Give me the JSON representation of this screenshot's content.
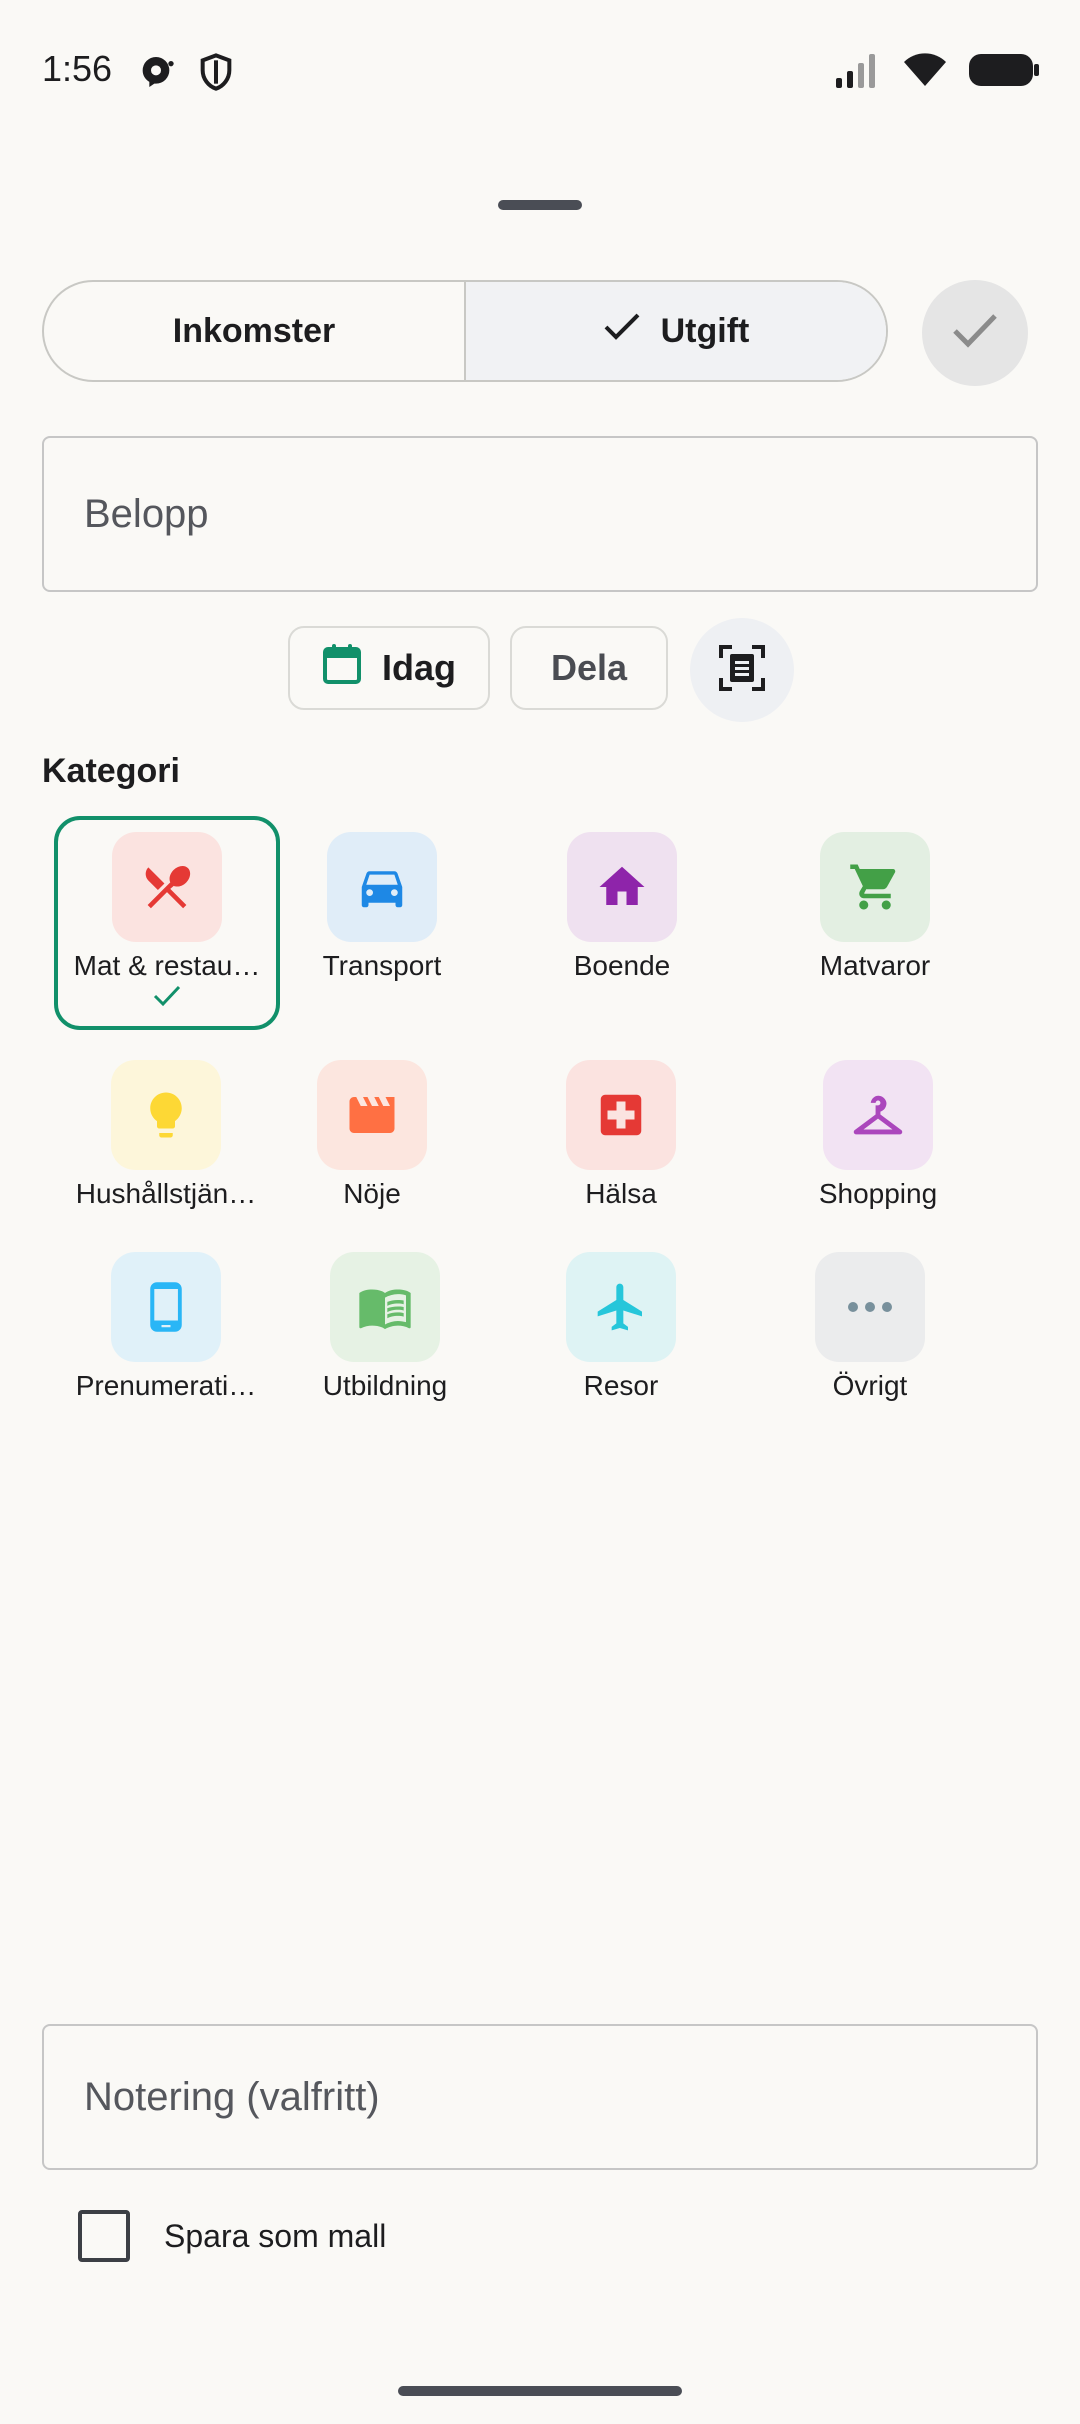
{
  "status_bar": {
    "time": "1:56",
    "icons": [
      "notification-icon",
      "shield-icon",
      "signal-icon",
      "wifi-icon",
      "battery-icon"
    ]
  },
  "type_toggle": {
    "income_label": "Inkomster",
    "expense_label": "Utgift",
    "selected": "Utgift"
  },
  "amount": {
    "placeholder": "Belopp",
    "value": ""
  },
  "chips": {
    "date_label": "Idag",
    "split_label": "Dela",
    "scan_icon": "scan-receipt-icon"
  },
  "category_section": {
    "title": "Kategori",
    "selected": "Mat & restau…",
    "items": [
      {
        "label": "Mat & restau…",
        "icon": "restaurant-icon",
        "color": "#e53935",
        "bg": "#fbe3e0"
      },
      {
        "label": "Transport",
        "icon": "car-icon",
        "color": "#1e88e5",
        "bg": "#e0edf8"
      },
      {
        "label": "Boende",
        "icon": "home-icon",
        "color": "#8e24aa",
        "bg": "#efe1f0"
      },
      {
        "label": "Matvaror",
        "icon": "cart-icon",
        "color": "#43a047",
        "bg": "#e3efe2"
      },
      {
        "label": "Hushållstjän…",
        "icon": "lightbulb-icon",
        "color": "#fdd835",
        "bg": "#fdf6da"
      },
      {
        "label": "Nöje",
        "icon": "movie-icon",
        "color": "#ff7043",
        "bg": "#fce6df"
      },
      {
        "label": "Hälsa",
        "icon": "medical-icon",
        "color": "#e53935",
        "bg": "#fbe3e0"
      },
      {
        "label": "Shopping",
        "icon": "hanger-icon",
        "color": "#ab47bc",
        "bg": "#f2e3f3"
      },
      {
        "label": "Prenumerati…",
        "icon": "phone-icon",
        "color": "#29b6f6",
        "bg": "#e0f1f9"
      },
      {
        "label": "Utbildning",
        "icon": "book-icon",
        "color": "#66bb6a",
        "bg": "#e6f2e4"
      },
      {
        "label": "Resor",
        "icon": "plane-icon",
        "color": "#26c6da",
        "bg": "#def3f4"
      },
      {
        "label": "Övrigt",
        "icon": "more-icon",
        "color": "#78909c",
        "bg": "#ebeced"
      }
    ]
  },
  "note": {
    "placeholder": "Notering (valfritt)",
    "value": ""
  },
  "save_template": {
    "label": "Spara som mall",
    "checked": false
  },
  "colors": {
    "accent": "#11906a",
    "background": "#faf9f6"
  }
}
